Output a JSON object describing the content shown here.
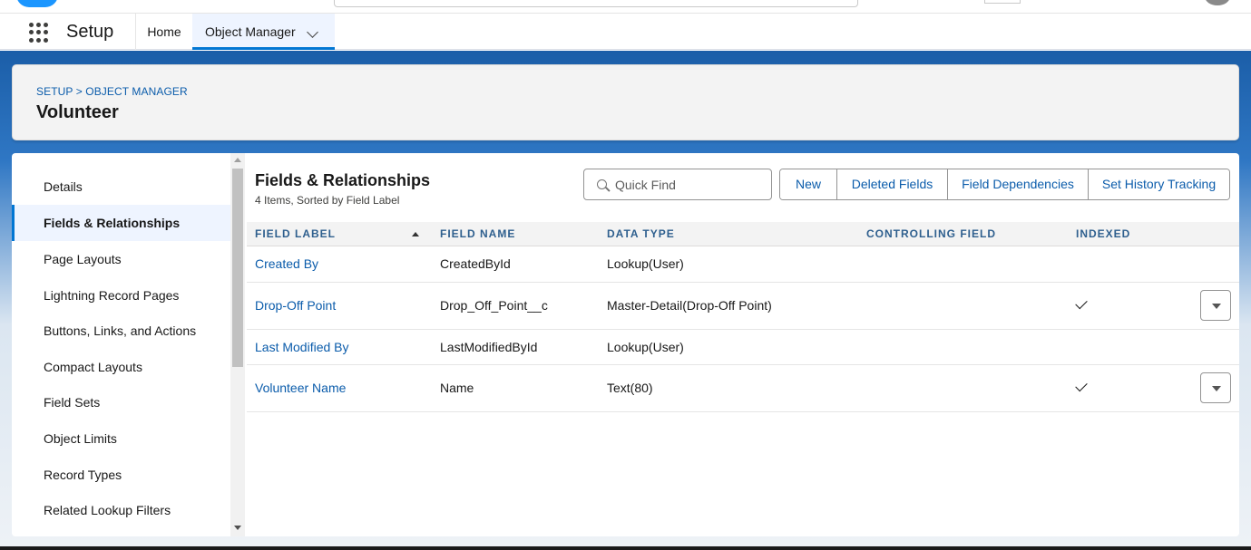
{
  "nav": {
    "app_name": "Setup",
    "home": "Home",
    "object_manager": "Object Manager"
  },
  "header": {
    "breadcrumb": "SETUP > OBJECT MANAGER",
    "title": "Volunteer"
  },
  "sidebar": {
    "items": [
      {
        "label": "Details",
        "active": false
      },
      {
        "label": "Fields & Relationships",
        "active": true
      },
      {
        "label": "Page Layouts",
        "active": false
      },
      {
        "label": "Lightning Record Pages",
        "active": false
      },
      {
        "label": "Buttons, Links, and Actions",
        "active": false
      },
      {
        "label": "Compact Layouts",
        "active": false
      },
      {
        "label": "Field Sets",
        "active": false
      },
      {
        "label": "Object Limits",
        "active": false
      },
      {
        "label": "Record Types",
        "active": false
      },
      {
        "label": "Related Lookup Filters",
        "active": false
      }
    ]
  },
  "section": {
    "title": "Fields & Relationships",
    "subtitle": "4 Items, Sorted by Field Label",
    "quick_find_placeholder": "Quick Find",
    "buttons": {
      "new": "New",
      "deleted_fields": "Deleted Fields",
      "field_dependencies": "Field Dependencies",
      "set_history_tracking": "Set History Tracking"
    }
  },
  "table": {
    "headers": {
      "field_label": "FIELD LABEL",
      "field_name": "FIELD NAME",
      "data_type": "DATA TYPE",
      "controlling_field": "CONTROLLING FIELD",
      "indexed": "INDEXED"
    },
    "sort": {
      "column": "field_label",
      "direction": "ascending"
    },
    "rows": [
      {
        "field_label": "Created By",
        "field_name": "CreatedById",
        "data_type": "Lookup(User)",
        "controlling_field": "",
        "indexed": false,
        "has_menu": false
      },
      {
        "field_label": "Drop-Off Point",
        "field_name": "Drop_Off_Point__c",
        "data_type": "Master-Detail(Drop-Off Point)",
        "controlling_field": "",
        "indexed": true,
        "has_menu": true
      },
      {
        "field_label": "Last Modified By",
        "field_name": "LastModifiedById",
        "data_type": "Lookup(User)",
        "controlling_field": "",
        "indexed": false,
        "has_menu": false
      },
      {
        "field_label": "Volunteer Name",
        "field_name": "Name",
        "data_type": "Text(80)",
        "controlling_field": "",
        "indexed": true,
        "has_menu": true
      }
    ]
  },
  "colors": {
    "accent": "#0176d3",
    "link": "#0b5cab",
    "active_bg": "#eef4ff",
    "header_bg": "#1b5ea8"
  }
}
